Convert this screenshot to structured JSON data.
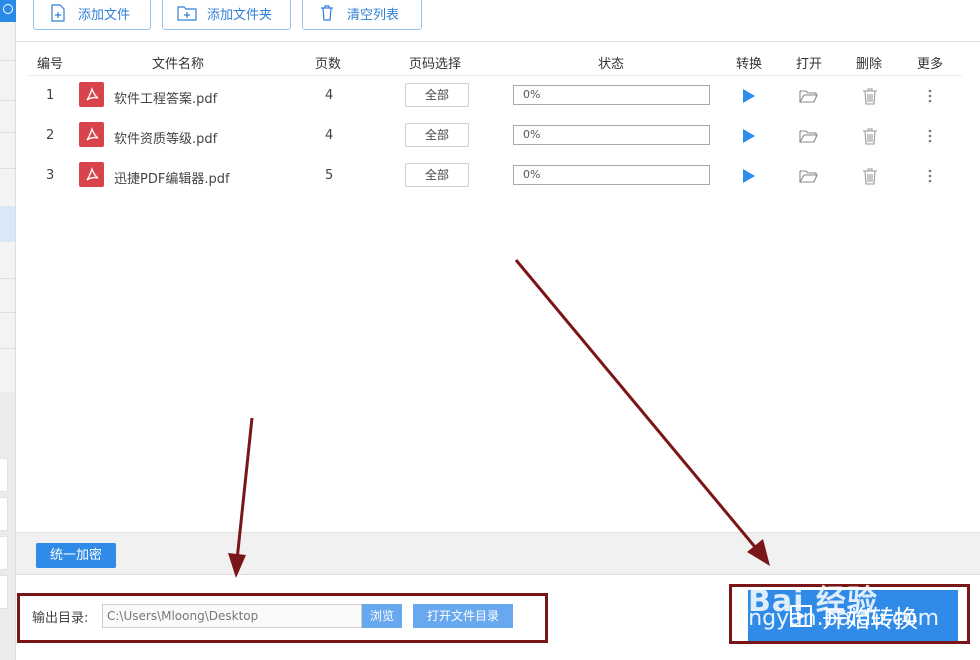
{
  "toolbar": {
    "add_file": "添加文件",
    "add_folder": "添加文件夹",
    "clear_list": "清空列表"
  },
  "table": {
    "headers": [
      "编号",
      "文件名称",
      "页数",
      "页码选择",
      "状态",
      "转换",
      "打开",
      "删除",
      "更多"
    ],
    "rows": [
      {
        "index": "1",
        "name": "软件工程答案.pdf",
        "pages": "4",
        "page_select": "全部",
        "status": "0%",
        "progress": 0
      },
      {
        "index": "2",
        "name": "软件资质等级.pdf",
        "pages": "4",
        "page_select": "全部",
        "status": "0%",
        "progress": 0
      },
      {
        "index": "3",
        "name": "迅捷PDF编辑器.pdf",
        "pages": "5",
        "page_select": "全部",
        "status": "0%",
        "progress": 0
      }
    ]
  },
  "encrypt": {
    "label": "统一加密"
  },
  "output": {
    "label": "输出目录:",
    "path": "C:\\Users\\Mloong\\Desktop",
    "browse": "浏览",
    "open_dir": "打开文件目录"
  },
  "start": {
    "label": "开始转换"
  },
  "watermark": {
    "logo": "Bai 经验",
    "url": "jingyan.baidu.com"
  },
  "colors": {
    "accent": "#2f8ae8",
    "highlight": "#7a1518",
    "pdf_icon": "#d9434b"
  }
}
